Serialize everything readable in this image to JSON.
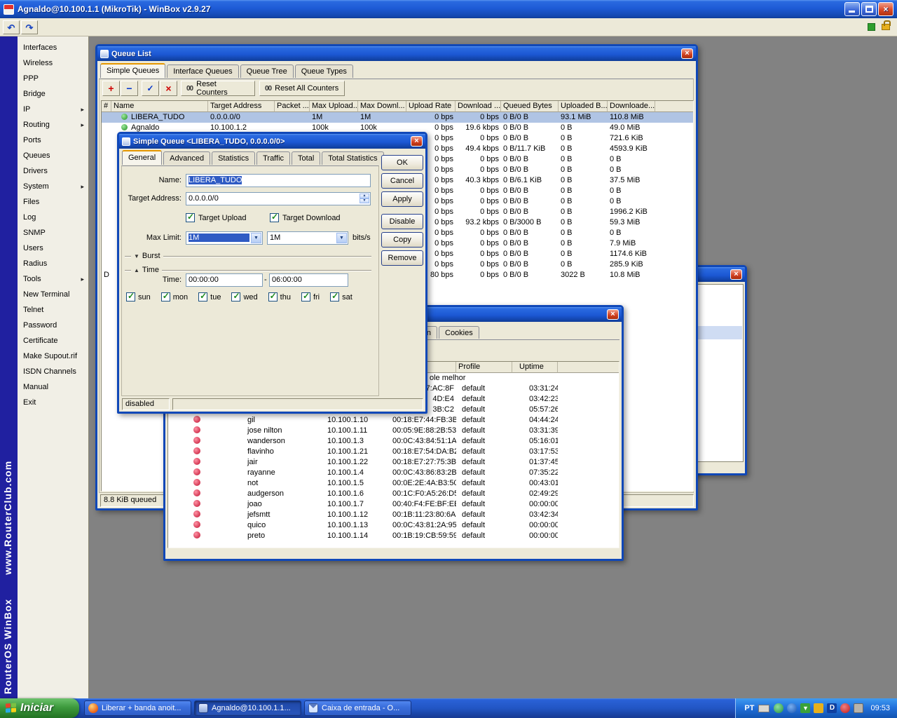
{
  "app": {
    "title": "Agnaldo@10.100.1.1 (MikroTik) - WinBox v2.9.27"
  },
  "icons": {
    "submenu_arrow": "▸",
    "undo": "↶",
    "redo": "↷",
    "close": "×",
    "check": "✓",
    "combo_arrow": "▼",
    "spin_up": "▲",
    "spin_down": "▼",
    "burst_collapsed": "▼",
    "time_expanded": "▲",
    "add": "+",
    "remove": "−",
    "enable": "✓",
    "disable": "×",
    "download_arrow": "▼",
    "dap_letter": "D"
  },
  "sidebar": {
    "items": [
      {
        "label": "Interfaces",
        "arrow": false
      },
      {
        "label": "Wireless",
        "arrow": false
      },
      {
        "label": "PPP",
        "arrow": false
      },
      {
        "label": "Bridge",
        "arrow": false
      },
      {
        "label": "IP",
        "arrow": true
      },
      {
        "label": "Routing",
        "arrow": true
      },
      {
        "label": "Ports",
        "arrow": false
      },
      {
        "label": "Queues",
        "arrow": false
      },
      {
        "label": "Drivers",
        "arrow": false
      },
      {
        "label": "System",
        "arrow": true
      },
      {
        "label": "Files",
        "arrow": false
      },
      {
        "label": "Log",
        "arrow": false
      },
      {
        "label": "SNMP",
        "arrow": false
      },
      {
        "label": "Users",
        "arrow": false
      },
      {
        "label": "Radius",
        "arrow": false
      },
      {
        "label": "Tools",
        "arrow": true
      },
      {
        "label": "New Terminal",
        "arrow": false
      },
      {
        "label": "Telnet",
        "arrow": false
      },
      {
        "label": "Password",
        "arrow": false
      },
      {
        "label": "Certificate",
        "arrow": false
      },
      {
        "label": "Make Supout.rif",
        "arrow": false
      },
      {
        "label": "ISDN Channels",
        "arrow": false
      },
      {
        "label": "Manual",
        "arrow": false
      },
      {
        "label": "Exit",
        "arrow": false
      }
    ],
    "brand_line1": "RouterOS WinBox",
    "brand_line2": "www.RouterClub.com"
  },
  "queue_list": {
    "title": "Queue List",
    "tabs": [
      {
        "label": "Simple Queues",
        "active": true
      },
      {
        "label": "Interface Queues",
        "active": false
      },
      {
        "label": "Queue Tree",
        "active": false
      },
      {
        "label": "Queue Types",
        "active": false
      }
    ],
    "toolbar": {
      "counter_prefix": "00",
      "reset_counters": "Reset Counters",
      "reset_all_counters": "Reset All Counters"
    },
    "columns": [
      "#",
      "Name",
      "Target Address",
      "Packet ...",
      "Max Upload...",
      "Max Downl...",
      "Upload Rate",
      "Download ...",
      "Queued Bytes",
      "Uploaded B...",
      "Downloade..."
    ],
    "rows": [
      {
        "flag": "",
        "name": "LIBERA_TUDO",
        "target": "0.0.0.0/0",
        "packet": "",
        "max_up": "1M",
        "max_down": "1M",
        "up_rate": "0 bps",
        "down_rate": "0 bps",
        "queued": "0 B/0 B",
        "uploaded": "93.1 MiB",
        "downloaded": "110.8 MiB",
        "selected": true
      },
      {
        "flag": "",
        "name": "Agnaldo",
        "target": "10.100.1.2",
        "packet": "",
        "max_up": "100k",
        "max_down": "100k",
        "up_rate": "0 bps",
        "down_rate": "19.6 kbps",
        "queued": "0 B/0 B",
        "uploaded": "0 B",
        "downloaded": "49.0 MiB",
        "selected": false
      },
      {
        "flag": "",
        "name": "",
        "target": "",
        "packet": "",
        "max_up": "",
        "max_down": "",
        "up_rate": "0 bps",
        "down_rate": "0 bps",
        "queued": "0 B/0 B",
        "uploaded": "0 B",
        "downloaded": "721.6 KiB",
        "selected": false
      },
      {
        "flag": "",
        "name": "",
        "target": "",
        "packet": "",
        "max_up": "",
        "max_down": "",
        "up_rate": "0 bps",
        "down_rate": "49.4 kbps",
        "queued": "0 B/11.7 KiB",
        "uploaded": "0 B",
        "downloaded": "4593.9 KiB",
        "selected": false
      },
      {
        "flag": "",
        "name": "",
        "target": "",
        "packet": "",
        "max_up": "",
        "max_down": "",
        "up_rate": "0 bps",
        "down_rate": "0 bps",
        "queued": "0 B/0 B",
        "uploaded": "0 B",
        "downloaded": "0 B",
        "selected": false
      },
      {
        "flag": "",
        "name": "",
        "target": "",
        "packet": "",
        "max_up": "",
        "max_down": "",
        "up_rate": "0 bps",
        "down_rate": "0 bps",
        "queued": "0 B/0 B",
        "uploaded": "0 B",
        "downloaded": "0 B",
        "selected": false
      },
      {
        "flag": "",
        "name": "",
        "target": "",
        "packet": "",
        "max_up": "",
        "max_down": "",
        "up_rate": "0 bps",
        "down_rate": "40.3 kbps",
        "queued": "0 B/6.1 KiB",
        "uploaded": "0 B",
        "downloaded": "37.5 MiB",
        "selected": false
      },
      {
        "flag": "",
        "name": "",
        "target": "",
        "packet": "",
        "max_up": "",
        "max_down": "",
        "up_rate": "0 bps",
        "down_rate": "0 bps",
        "queued": "0 B/0 B",
        "uploaded": "0 B",
        "downloaded": "0 B",
        "selected": false
      },
      {
        "flag": "",
        "name": "",
        "target": "",
        "packet": "",
        "max_up": "",
        "max_down": "",
        "up_rate": "0 bps",
        "down_rate": "0 bps",
        "queued": "0 B/0 B",
        "uploaded": "0 B",
        "downloaded": "0 B",
        "selected": false
      },
      {
        "flag": "",
        "name": "",
        "target": "",
        "packet": "",
        "max_up": "",
        "max_down": "",
        "up_rate": "0 bps",
        "down_rate": "0 bps",
        "queued": "0 B/0 B",
        "uploaded": "0 B",
        "downloaded": "1996.2 KiB",
        "selected": false
      },
      {
        "flag": "",
        "name": "",
        "target": "",
        "packet": "",
        "max_up": "",
        "max_down": "",
        "up_rate": "0 bps",
        "down_rate": "93.2 kbps",
        "queued": "0 B/3000 B",
        "uploaded": "0 B",
        "downloaded": "59.3 MiB",
        "selected": false
      },
      {
        "flag": "",
        "name": "",
        "target": "",
        "packet": "",
        "max_up": "",
        "max_down": "",
        "up_rate": "0 bps",
        "down_rate": "0 bps",
        "queued": "0 B/0 B",
        "uploaded": "0 B",
        "downloaded": "0 B",
        "selected": false
      },
      {
        "flag": "",
        "name": "",
        "target": "",
        "packet": "",
        "max_up": "",
        "max_down": "",
        "up_rate": "0 bps",
        "down_rate": "0 bps",
        "queued": "0 B/0 B",
        "uploaded": "0 B",
        "downloaded": "7.9 MiB",
        "selected": false
      },
      {
        "flag": "",
        "name": "",
        "target": "",
        "packet": "",
        "max_up": "",
        "max_down": "",
        "up_rate": "0 bps",
        "down_rate": "0 bps",
        "queued": "0 B/0 B",
        "uploaded": "0 B",
        "downloaded": "1174.6 KiB",
        "selected": false
      },
      {
        "flag": "",
        "name": "",
        "target": "",
        "packet": "",
        "max_up": "",
        "max_down": "",
        "up_rate": "0 bps",
        "down_rate": "0 bps",
        "queued": "0 B/0 B",
        "uploaded": "0 B",
        "downloaded": "285.9 KiB",
        "selected": false
      },
      {
        "flag": "D",
        "name": "",
        "target": "",
        "packet": "",
        "max_up": "",
        "max_down": "",
        "up_rate": "80 bps",
        "down_rate": "0 bps",
        "queued": "0 B/0 B",
        "uploaded": "3022 B",
        "downloaded": "10.8 MiB",
        "selected": false
      }
    ],
    "status": "8.8 KiB queued"
  },
  "simple_queue_dialog": {
    "title": "Simple Queue <LIBERA_TUDO, 0.0.0.0/0>",
    "tabs": [
      {
        "label": "General",
        "active": true
      },
      {
        "label": "Advanced",
        "active": false
      },
      {
        "label": "Statistics",
        "active": false
      },
      {
        "label": "Traffic",
        "active": false
      },
      {
        "label": "Total",
        "active": false
      },
      {
        "label": "Total Statistics",
        "active": false
      }
    ],
    "fields": {
      "name_label": "Name:",
      "name_value": "LIBERA_TUDO",
      "target_address_label": "Target Address:",
      "target_address_value": "0.0.0.0/0",
      "target_upload_label": "Target Upload",
      "target_download_label": "Target Download",
      "max_limit_label": "Max Limit:",
      "max_upload_value": "1M",
      "max_download_value": "1M",
      "units": "bits/s",
      "burst_section": "Burst",
      "time_section": "Time",
      "time_label": "Time:",
      "time_from": "00:00:00",
      "time_separator": "-",
      "time_to": "06:00:00",
      "days": [
        "sun",
        "mon",
        "tue",
        "wed",
        "thu",
        "fri",
        "sat"
      ]
    },
    "buttons": [
      "OK",
      "Cancel",
      "Apply",
      "Disable",
      "Copy",
      "Remove"
    ],
    "status": "disabled"
  },
  "hotspot_window": {
    "title": "",
    "tabs": [
      {
        "label": "en"
      },
      {
        "label": "Cookies"
      }
    ],
    "columns": {
      "profile": "Profile",
      "uptime": "Uptime"
    },
    "rows": [
      {
        "type": "comment",
        "text": "ole melhor"
      },
      {
        "type": "partial",
        "mac": "7:AC:8F",
        "profile": "default",
        "uptime": "03:31:24"
      },
      {
        "type": "partial",
        "mac": "4D:E4",
        "profile": "default",
        "uptime": "03:42:23"
      },
      {
        "type": "partial",
        "mac": "3B:C2",
        "profile": "default",
        "uptime": "05:57:26"
      },
      {
        "type": "full",
        "user": "gil",
        "address": "10.100.1.10",
        "mac": "00:18:E7:44:FB:3B",
        "profile": "default",
        "uptime": "04:44:24"
      },
      {
        "type": "full",
        "user": "jose nilton",
        "address": "10.100.1.11",
        "mac": "00:05:9E:88:2B:53",
        "profile": "default",
        "uptime": "03:31:39"
      },
      {
        "type": "full",
        "user": "wanderson",
        "address": "10.100.1.3",
        "mac": "00:0C:43:84:51:1A",
        "profile": "default",
        "uptime": "05:16:01"
      },
      {
        "type": "full",
        "user": "flavinho",
        "address": "10.100.1.21",
        "mac": "00:18:E7:54:DA:B2",
        "profile": "default",
        "uptime": "03:17:53"
      },
      {
        "type": "full",
        "user": "jair",
        "address": "10.100.1.22",
        "mac": "00:18:E7:27:75:3B",
        "profile": "default",
        "uptime": "01:37:45"
      },
      {
        "type": "full",
        "user": "rayanne",
        "address": "10.100.1.4",
        "mac": "00:0C:43:86:83:2B",
        "profile": "default",
        "uptime": "07:35:22"
      },
      {
        "type": "full",
        "user": "not",
        "address": "10.100.1.5",
        "mac": "00:0E:2E:4A:B3:50",
        "profile": "default",
        "uptime": "00:43:01"
      },
      {
        "type": "full",
        "user": "audgerson",
        "address": "10.100.1.6",
        "mac": "00:1C:F0:A5:26:D5",
        "profile": "default",
        "uptime": "02:49:29"
      },
      {
        "type": "full",
        "user": "joao",
        "address": "10.100.1.7",
        "mac": "00:40:F4:FE:BF:EE",
        "profile": "default",
        "uptime": "00:00:00"
      },
      {
        "type": "full",
        "user": "jefsmtt",
        "address": "10.100.1.12",
        "mac": "00:1B:11:23:80:6A",
        "profile": "default",
        "uptime": "03:42:34"
      },
      {
        "type": "full",
        "user": "quico",
        "address": "10.100.1.13",
        "mac": "00:0C:43:81:2A:95",
        "profile": "default",
        "uptime": "00:00:00"
      },
      {
        "type": "full",
        "user": "preto",
        "address": "10.100.1.14",
        "mac": "00:1B:19:CB:59:59",
        "profile": "default",
        "uptime": "00:00:00"
      }
    ]
  },
  "background_window": {
    "title": ""
  },
  "taskbar": {
    "start_label": "Iniciar",
    "tasks": [
      {
        "label": "Liberar + banda anoit...",
        "icon": "browser",
        "active": false
      },
      {
        "label": "Agnaldo@10.100.1.1...",
        "icon": "winbox",
        "active": true
      },
      {
        "label": "Caixa de entrada - O...",
        "icon": "mail",
        "active": false
      }
    ],
    "tray": {
      "language": "PT",
      "icons": [
        "messenger",
        "update",
        "download",
        "scheduler",
        "dap",
        "antivirus",
        "printer"
      ],
      "clock": "09:53"
    }
  }
}
